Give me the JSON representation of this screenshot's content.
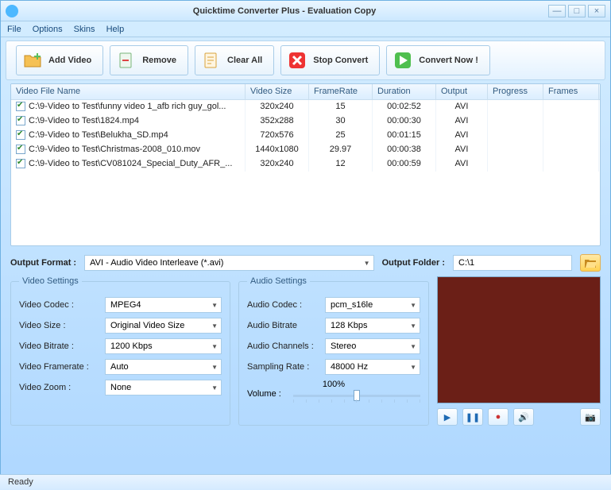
{
  "title": "Quicktime Converter Plus - Evaluation Copy",
  "menu": {
    "file": "File",
    "options": "Options",
    "skins": "Skins",
    "help": "Help"
  },
  "toolbar": {
    "add_video": "Add Video",
    "remove": "Remove",
    "clear_all": "Clear All",
    "stop_convert": "Stop Convert",
    "convert_now": "Convert Now !"
  },
  "grid": {
    "headers": {
      "name": "Video File Name",
      "size": "Video Size",
      "fps": "FrameRate",
      "dur": "Duration",
      "out": "Output",
      "prog": "Progress",
      "frames": "Frames"
    },
    "rows": [
      {
        "name": "C:\\9-Video to Test\\funny video 1_afb rich guy_gol...",
        "size": "320x240",
        "fps": "15",
        "dur": "00:02:52",
        "out": "AVI"
      },
      {
        "name": "C:\\9-Video to Test\\1824.mp4",
        "size": "352x288",
        "fps": "30",
        "dur": "00:00:30",
        "out": "AVI"
      },
      {
        "name": "C:\\9-Video to Test\\Belukha_SD.mp4",
        "size": "720x576",
        "fps": "25",
        "dur": "00:01:15",
        "out": "AVI"
      },
      {
        "name": "C:\\9-Video to Test\\Christmas-2008_010.mov",
        "size": "1440x1080",
        "fps": "29.97",
        "dur": "00:00:38",
        "out": "AVI"
      },
      {
        "name": "C:\\9-Video to Test\\CV081024_Special_Duty_AFR_...",
        "size": "320x240",
        "fps": "12",
        "dur": "00:00:59",
        "out": "AVI"
      }
    ]
  },
  "format": {
    "output_format_label": "Output Format :",
    "output_format_value": "AVI - Audio Video Interleave (*.avi)",
    "output_folder_label": "Output Folder :",
    "output_folder_value": "C:\\1"
  },
  "video_settings": {
    "legend": "Video Settings",
    "codec_label": "Video Codec :",
    "codec_value": "MPEG4",
    "size_label": "Video Size :",
    "size_value": "Original Video Size",
    "bitrate_label": "Video Bitrate :",
    "bitrate_value": "1200 Kbps",
    "framerate_label": "Video Framerate :",
    "framerate_value": "Auto",
    "zoom_label": "Video Zoom :",
    "zoom_value": "None"
  },
  "audio_settings": {
    "legend": "Audio Settings",
    "codec_label": "Audio Codec :",
    "codec_value": "pcm_s16le",
    "bitrate_label": "Audio Bitrate",
    "bitrate_value": "128 Kbps",
    "channels_label": "Audio Channels :",
    "channels_value": "Stereo",
    "rate_label": "Sampling Rate :",
    "rate_value": "48000 Hz",
    "volume_label": "Volume :",
    "volume_pct": "100%"
  },
  "status": "Ready"
}
